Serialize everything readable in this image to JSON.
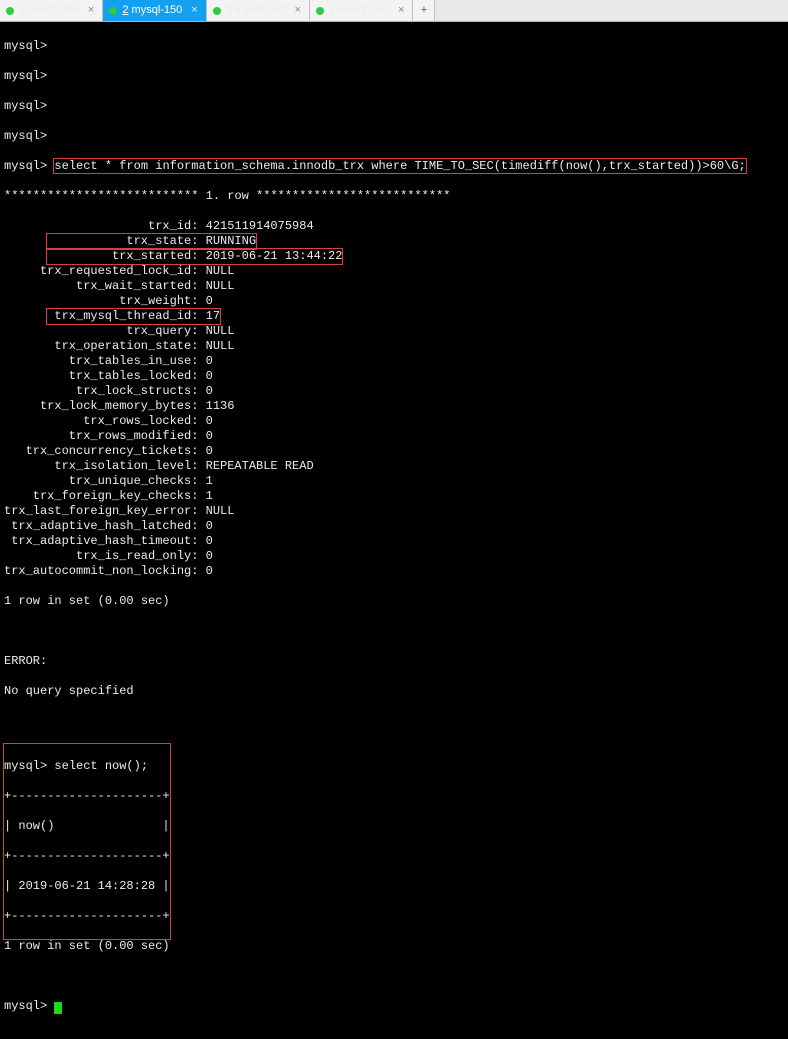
{
  "tabs": [
    {
      "num": "1",
      "label": "mysql-150",
      "active": false
    },
    {
      "num": "2",
      "label": "mysql-150",
      "active": true
    },
    {
      "num": "3",
      "label": "mysql-150",
      "active": false
    },
    {
      "num": "4",
      "label": "mysql-150",
      "active": false
    }
  ],
  "prompt": "mysql>",
  "sql": {
    "query": "select * from information_schema.innodb_trx where TIME_TO_SEC(timediff(now(),trx_started))>60\\G;",
    "row_header": "*************************** 1. row ***************************",
    "footer": "1 row in set (0.00 sec)",
    "error_label": "ERROR:",
    "error_msg": "No query specified"
  },
  "fields": [
    {
      "label": "trx_id",
      "value": "421511914075984",
      "hl": false
    },
    {
      "label": "trx_state",
      "value": "RUNNING",
      "hl": true
    },
    {
      "label": "trx_started",
      "value": "2019-06-21 13:44:22",
      "hl": true
    },
    {
      "label": "trx_requested_lock_id",
      "value": "NULL",
      "hl": false
    },
    {
      "label": "trx_wait_started",
      "value": "NULL",
      "hl": false
    },
    {
      "label": "trx_weight",
      "value": "0",
      "hl": false
    },
    {
      "label": "trx_mysql_thread_id",
      "value": "17",
      "hl": true
    },
    {
      "label": "trx_query",
      "value": "NULL",
      "hl": false
    },
    {
      "label": "trx_operation_state",
      "value": "NULL",
      "hl": false
    },
    {
      "label": "trx_tables_in_use",
      "value": "0",
      "hl": false
    },
    {
      "label": "trx_tables_locked",
      "value": "0",
      "hl": false
    },
    {
      "label": "trx_lock_structs",
      "value": "0",
      "hl": false
    },
    {
      "label": "trx_lock_memory_bytes",
      "value": "1136",
      "hl": false
    },
    {
      "label": "trx_rows_locked",
      "value": "0",
      "hl": false
    },
    {
      "label": "trx_rows_modified",
      "value": "0",
      "hl": false
    },
    {
      "label": "trx_concurrency_tickets",
      "value": "0",
      "hl": false
    },
    {
      "label": "trx_isolation_level",
      "value": "REPEATABLE READ",
      "hl": false
    },
    {
      "label": "trx_unique_checks",
      "value": "1",
      "hl": false
    },
    {
      "label": "trx_foreign_key_checks",
      "value": "1",
      "hl": false
    },
    {
      "label": "trx_last_foreign_key_error",
      "value": "NULL",
      "hl": false
    },
    {
      "label": "trx_adaptive_hash_latched",
      "value": "0",
      "hl": false
    },
    {
      "label": "trx_adaptive_hash_timeout",
      "value": "0",
      "hl": false
    },
    {
      "label": "trx_is_read_only",
      "value": "0",
      "hl": false
    },
    {
      "label": "trx_autocommit_non_locking",
      "value": "0",
      "hl": false
    }
  ],
  "now_block": {
    "query": "select now();",
    "sep": "+---------------------+",
    "head": "| now()               |",
    "row": "| 2019-06-21 14:28:28 |",
    "footer": "1 row in set (0.00 sec)"
  },
  "final_prompt": "mysql> "
}
